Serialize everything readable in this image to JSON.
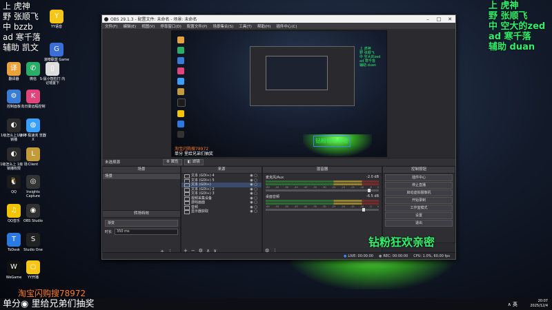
{
  "overlay_left": {
    "line1": "上 虎神",
    "line2": "野 张顺飞",
    "line3": "中 bzzb",
    "line4": "ad 寒千落",
    "line5": "辅助 凯文"
  },
  "overlay_right": {
    "line1": "上 虎神",
    "line2": "野 张顺飞",
    "line3": "中 空大的zed",
    "line4": "ad 寒千落",
    "line5": "辅助 duan"
  },
  "desktop_icons": [
    {
      "label": "YY语音",
      "color": "#f5c518",
      "glyph": "Y"
    },
    {
      "label": "滚榜联盟 Game喂",
      "color": "#3a6fd8",
      "glyph": "G"
    },
    {
      "label": "翻译器",
      "color": "#e8a23a",
      "glyph": "译"
    },
    {
      "label": "微信",
      "color": "#2aae67",
      "glyph": "✆"
    },
    {
      "label": "S-鼠小智粒打 内记墙置下",
      "color": "#dddddd",
      "glyph": "▯"
    },
    {
      "label": "控制面板",
      "color": "#3a7bd5",
      "glyph": "⚙"
    },
    {
      "label": "向日葵远程控制",
      "color": "#e0457b",
      "glyph": "K"
    },
    {
      "label": "1级怎么上1级 不锁播",
      "color": "#2b2b2b",
      "glyph": "◐"
    },
    {
      "label": "360 极速浏 览器X",
      "color": "#3aa0ff",
      "glyph": "◍"
    },
    {
      "label": "1级怎么上 1级 场锁播权限",
      "color": "#2b2b2b",
      "glyph": "◐"
    },
    {
      "label": "Client",
      "color": "#c49b3a",
      "glyph": "L"
    },
    {
      "label": "QQ",
      "color": "#1b1b1b",
      "glyph": "🐧"
    },
    {
      "label": "Insights Capture",
      "color": "#333333",
      "glyph": "◎"
    },
    {
      "label": "QQ音乐",
      "color": "#f2c500",
      "glyph": "♫"
    },
    {
      "label": "OBS Studio",
      "color": "#303030",
      "glyph": "◉"
    },
    {
      "label": "ToDesk",
      "color": "#2a7ae2",
      "glyph": "T"
    },
    {
      "label": "Studio One",
      "color": "#222222",
      "glyph": "S"
    },
    {
      "label": "WeGame",
      "color": "#111111",
      "glyph": "W"
    },
    {
      "label": "YY开播",
      "color": "#f5c518",
      "glyph": "○"
    }
  ],
  "obs": {
    "title": "OBS 29.1.3 - 配置文件: 未命名 - 场景: 未命名",
    "menu": [
      "文件(F)",
      "编辑(E)",
      "视图(V)",
      "停靠窗口(D)",
      "配置文件(P)",
      "场景集合(S)",
      "工具(T)",
      "帮助(H)",
      "插件中心(C)"
    ],
    "preview_text": {
      "streamers": "上 虎神\n野 张顺飞\n中 空大的zed\nad 寒千落\n辅助 duan",
      "fan_box": "钻粉狂欢亲密",
      "ticker1": "淘宝闪购搜78972",
      "ticker2": "单分 里给兄弟们抽奖"
    },
    "scene_bar": {
      "label": "未选择源",
      "properties": "属性",
      "filters": "滤镜"
    },
    "scenes": {
      "header": "场景",
      "items": [
        "场景"
      ]
    },
    "transitions": {
      "header": "转场特效",
      "type": "渐变",
      "duration_label": "时长",
      "duration": "350 ms"
    },
    "sources": {
      "header": "来源",
      "items": [
        "文本 (GDI+) 4",
        "文本 (GDI+) 5",
        "文本 (GDI+)",
        "文本 (GDI+) 2",
        "文本 (GDI+) 3",
        "视频采集设备",
        "游戏画面",
        "音频",
        "显示器获取"
      ]
    },
    "mixer": {
      "header": "混音器",
      "channels": [
        {
          "name": "麦克风/Aux",
          "level": "-2.0 dB"
        },
        {
          "name": "桌面音频",
          "level": "-6.5 dB"
        }
      ],
      "scale": [
        "-60",
        "-55",
        "-50",
        "-45",
        "-40",
        "-35",
        "-30",
        "-25",
        "-20",
        "-15",
        "-10",
        "-5",
        "0"
      ]
    },
    "controls": {
      "header": "控制按钮",
      "buttons": [
        "插件中心",
        "停止直播",
        "启动虚拟摄像机",
        "开始录制",
        "工作室模式",
        "设置",
        "退出"
      ]
    },
    "status": {
      "live": "LIVE: 00:00:00",
      "rec": "REC: 00:00:00",
      "cpu": "CPU: 1.0%, 60.00 fps"
    },
    "overlay_fan": "钻粉狂欢亲密"
  },
  "taskbar": {
    "ticker_main": "单分◉ 里给兄弟们抽奖",
    "taobao": "淘宝闪购搜78972",
    "ime": "英",
    "time": "20:07",
    "date": "2025/12/4"
  }
}
